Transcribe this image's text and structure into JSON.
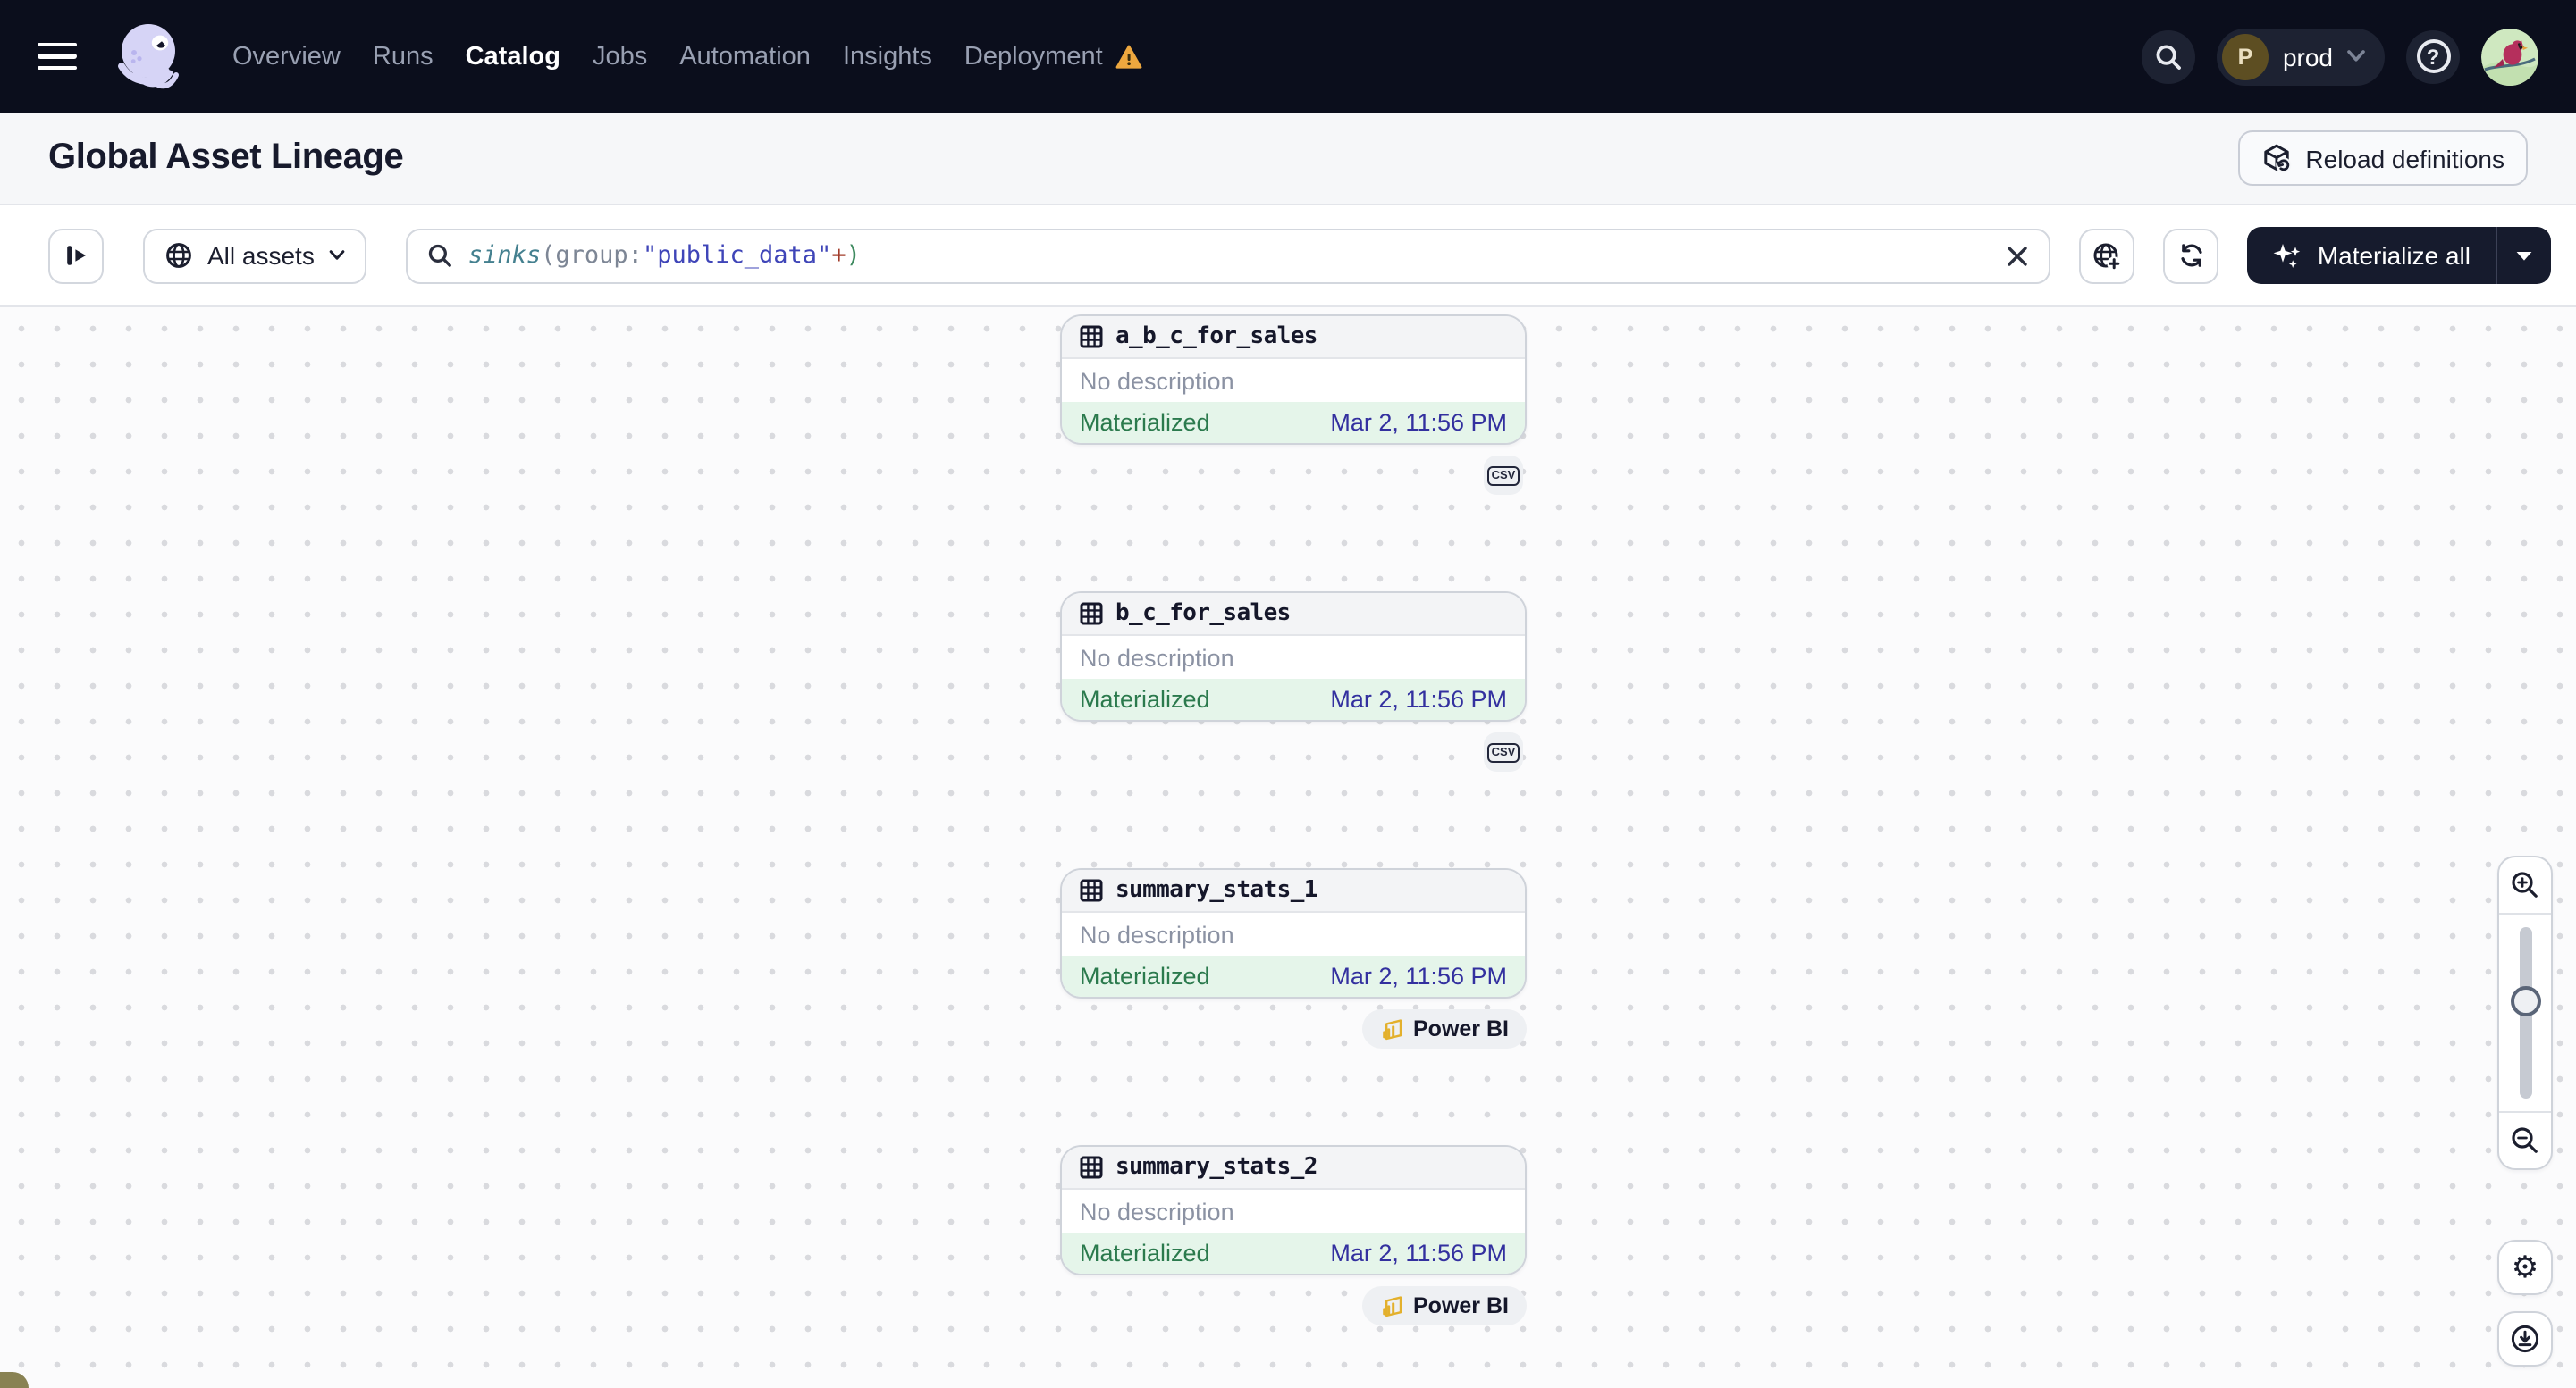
{
  "nav": {
    "items": [
      {
        "label": "Overview"
      },
      {
        "label": "Runs"
      },
      {
        "label": "Catalog"
      },
      {
        "label": "Jobs"
      },
      {
        "label": "Automation"
      },
      {
        "label": "Insights"
      },
      {
        "label": "Deployment"
      }
    ],
    "active_item": "Catalog",
    "env": {
      "initial": "P",
      "label": "prod"
    },
    "help_glyph": "?"
  },
  "header": {
    "title": "Global Asset Lineage",
    "reload_label": "Reload definitions"
  },
  "toolbar": {
    "scope_label": "All assets",
    "materialize_label": "Materialize all",
    "query": {
      "fn": "sinks",
      "open_paren": "(",
      "key": "group:",
      "value": "\"public_data\"",
      "plus": "+",
      "close_paren": ")"
    }
  },
  "canvas": {
    "nodes": [
      {
        "name": "a_b_c_for_sales",
        "description": "No description",
        "status": "Materialized",
        "timestamp": "Mar 2, 11:56 PM",
        "kind": "csv",
        "kind_label": "CSV"
      },
      {
        "name": "b_c_for_sales",
        "description": "No description",
        "status": "Materialized",
        "timestamp": "Mar 2, 11:56 PM",
        "kind": "csv",
        "kind_label": "CSV"
      },
      {
        "name": "summary_stats_1",
        "description": "No description",
        "status": "Materialized",
        "timestamp": "Mar 2, 11:56 PM",
        "kind": "powerbi",
        "kind_label": "Power BI"
      },
      {
        "name": "summary_stats_2",
        "description": "No description",
        "status": "Materialized",
        "timestamp": "Mar 2, 11:56 PM",
        "kind": "powerbi",
        "kind_label": "Power BI"
      }
    ]
  },
  "colors": {
    "nav_bg": "#0b0e1c",
    "brand_lavender": "#d6d4f6",
    "materialized_green": "#2b7a4d",
    "materialized_bg": "#e5f5ea",
    "timestamp_indigo": "#33309f",
    "warning_orange": "#eda73f",
    "powerbi_yellow": "#e3b02c",
    "dark_button": "#161b2d"
  }
}
